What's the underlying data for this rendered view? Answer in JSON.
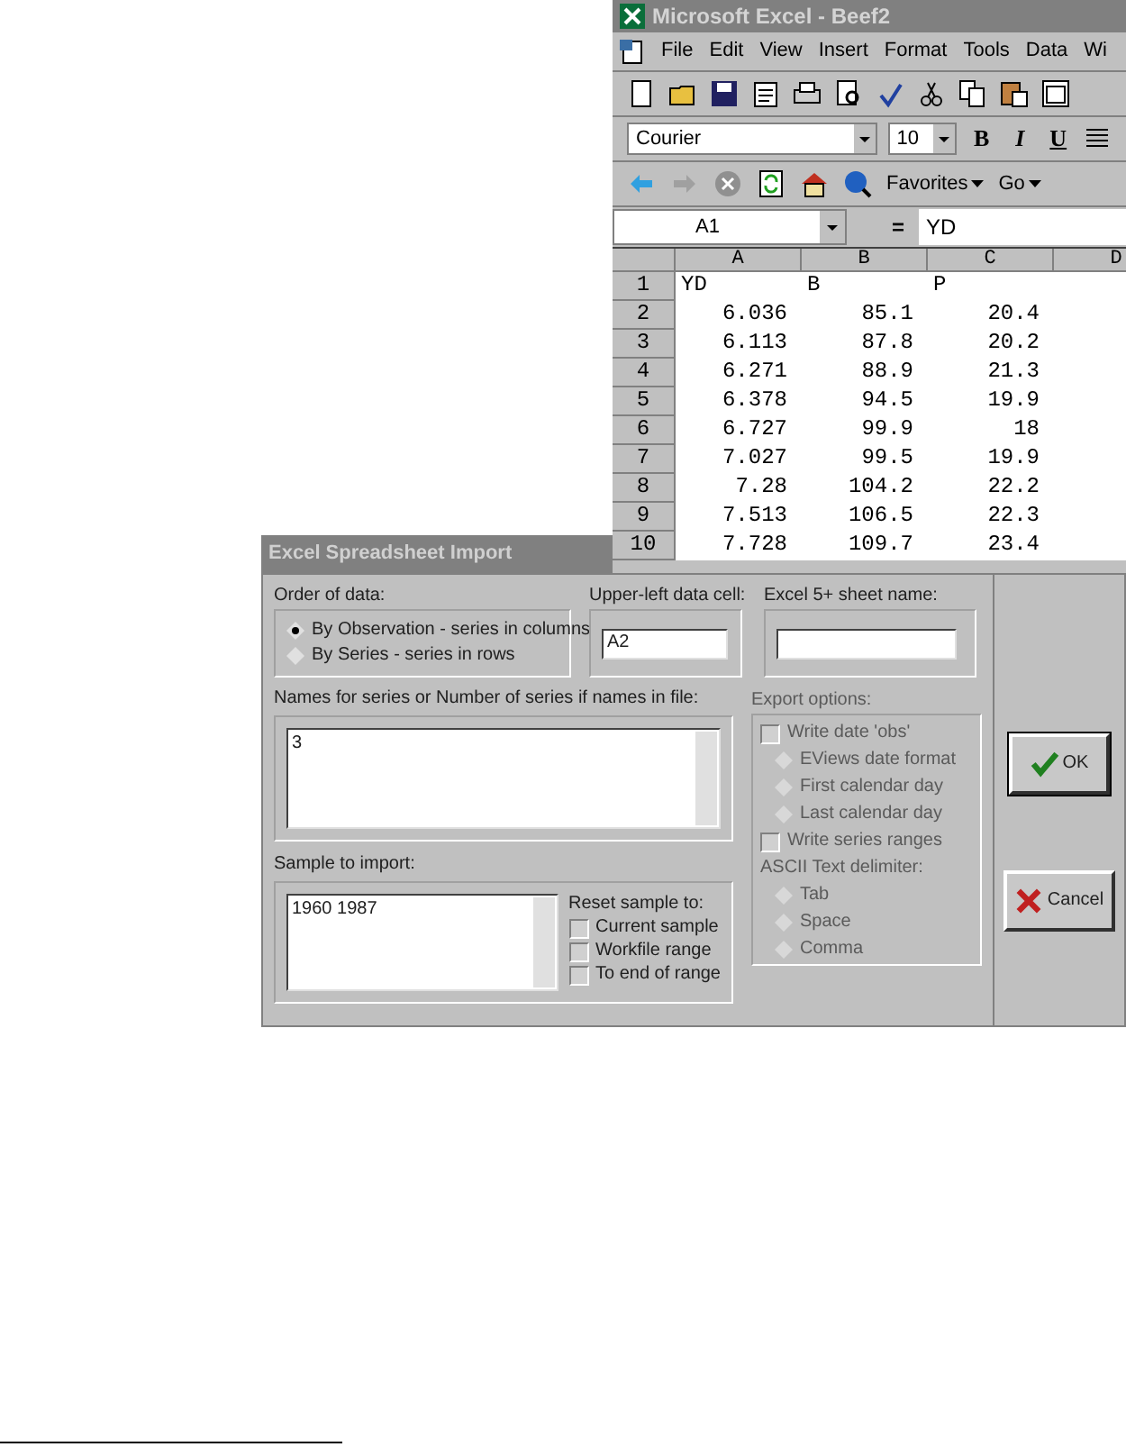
{
  "excel": {
    "title": "Microsoft Excel - Beef2",
    "menu": [
      "File",
      "Edit",
      "View",
      "Insert",
      "Format",
      "Tools",
      "Data",
      "Wi"
    ],
    "font_name": "Courier",
    "font_size": "10",
    "format_buttons": [
      "B",
      "I",
      "U"
    ],
    "web_toolbar": [
      "Favorites",
      "Go"
    ],
    "name_box": "A1",
    "equals": "=",
    "formula": "YD",
    "columns": [
      "A",
      "B",
      "C",
      "D"
    ],
    "rows": [
      {
        "header": "1",
        "kind": "labels",
        "cells": [
          "YD",
          "B",
          "P"
        ]
      },
      {
        "header": "2",
        "kind": "numbers",
        "cells": [
          "6.036",
          "85.1",
          "20.4"
        ]
      },
      {
        "header": "3",
        "kind": "numbers",
        "cells": [
          "6.113",
          "87.8",
          "20.2"
        ]
      },
      {
        "header": "4",
        "kind": "numbers",
        "cells": [
          "6.271",
          "88.9",
          "21.3"
        ]
      },
      {
        "header": "5",
        "kind": "numbers",
        "cells": [
          "6.378",
          "94.5",
          "19.9"
        ]
      },
      {
        "header": "6",
        "kind": "numbers",
        "cells": [
          "6.727",
          "99.9",
          "18"
        ]
      },
      {
        "header": "7",
        "kind": "numbers",
        "cells": [
          "7.027",
          "99.5",
          "19.9"
        ]
      },
      {
        "header": "8",
        "kind": "numbers",
        "cells": [
          "7.28",
          "104.2",
          "22.2"
        ]
      },
      {
        "header": "9",
        "kind": "numbers",
        "cells": [
          "7.513",
          "106.5",
          "22.3"
        ]
      },
      {
        "header": "10",
        "kind": "numbers",
        "cells": [
          "7.728",
          "109.7",
          "23.4"
        ]
      }
    ]
  },
  "dialog": {
    "title": "Excel Spreadsheet Import",
    "order_label": "Order of data:",
    "order_options": [
      {
        "label": "By Observation - series in columns",
        "selected": true
      },
      {
        "label": "By Series - series in rows",
        "selected": false
      }
    ],
    "cell_label": "Upper-left data cell:",
    "cell_value": "A2",
    "sheet_label": "Excel 5+ sheet name:",
    "names_label": "Names for series or Number of series if names in file:",
    "names_value": "3",
    "sample_label": "Sample to import:",
    "sample_value": "1960 1987",
    "reset_label": "Reset sample to:",
    "reset_options": [
      {
        "label": "Current sample",
        "checked": false
      },
      {
        "label": "Workfile range",
        "checked": false
      },
      {
        "label": "To end of range",
        "checked": false
      }
    ],
    "export": {
      "label": "Export options:",
      "disabled": true,
      "items": [
        {
          "kind": "checkbox",
          "label": "Write date 'obs'",
          "checked": false
        },
        {
          "kind": "radio",
          "label": "EViews date format",
          "selected": false
        },
        {
          "kind": "radio",
          "label": "First calendar day",
          "selected": false
        },
        {
          "kind": "radio",
          "label": "Last calendar day",
          "selected": false
        },
        {
          "kind": "checkbox",
          "label": "Write series ranges",
          "checked": false
        },
        {
          "kind": "heading",
          "label": "ASCII Text delimiter:"
        },
        {
          "kind": "radio",
          "label": "Tab",
          "selected": false
        },
        {
          "kind": "radio",
          "label": "Space",
          "selected": false
        },
        {
          "kind": "radio",
          "label": "Comma",
          "selected": false
        }
      ]
    },
    "buttons": [
      {
        "kind": "ok",
        "label": "OK"
      },
      {
        "kind": "cancel",
        "label": "Cancel"
      }
    ]
  }
}
